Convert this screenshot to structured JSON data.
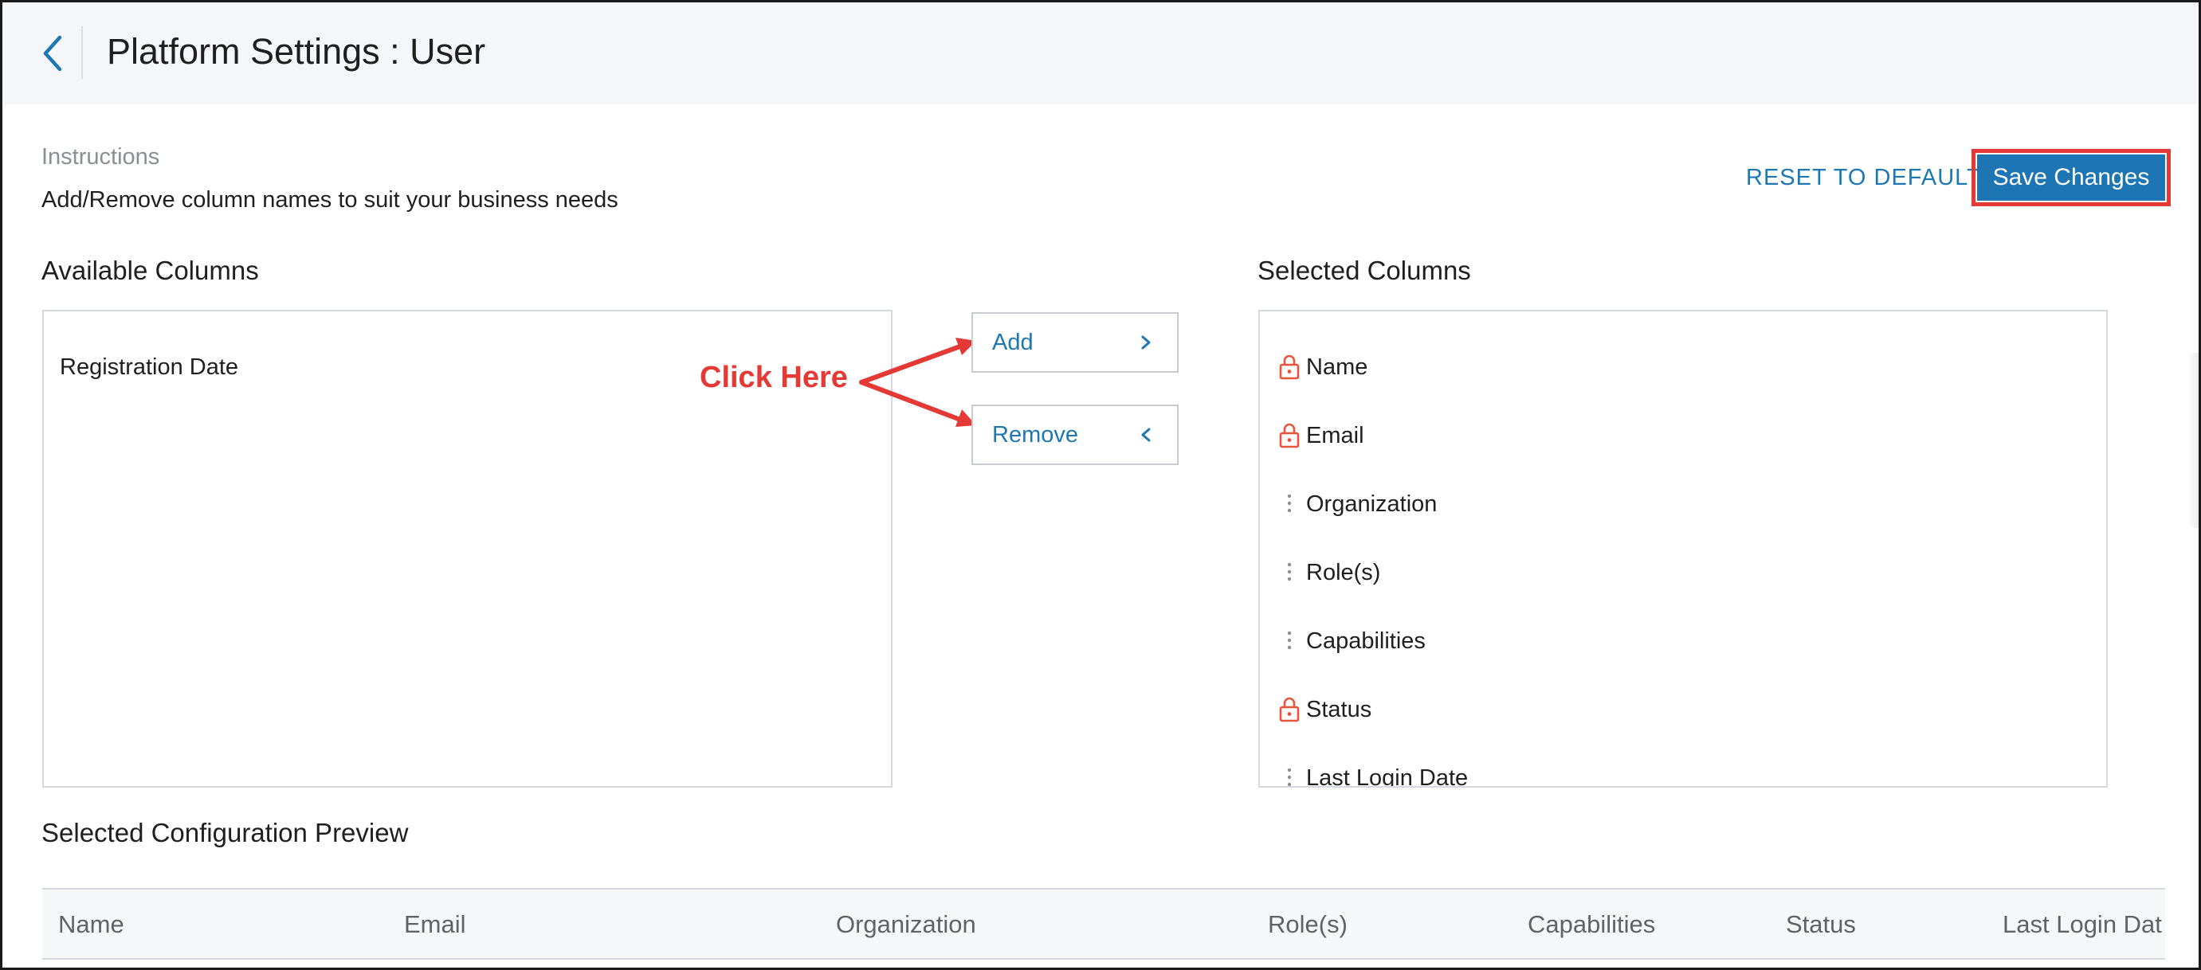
{
  "header": {
    "title": "Platform Settings : User",
    "back_icon": "chevron-left-icon"
  },
  "instructions": {
    "label": "Instructions",
    "text": "Add/Remove column names to suit your business needs"
  },
  "actions": {
    "reset_label": "RESET TO DEFAULT",
    "save_label": "Save Changes"
  },
  "available": {
    "title": "Available Columns",
    "items": [
      "Registration Date"
    ]
  },
  "transfer": {
    "add_label": "Add",
    "remove_label": "Remove",
    "annotation": "Click Here"
  },
  "selected": {
    "title": "Selected Columns",
    "items": [
      {
        "label": "Name",
        "icon": "lock-icon"
      },
      {
        "label": "Email",
        "icon": "lock-icon"
      },
      {
        "label": "Organization",
        "icon": "drag-handle-icon"
      },
      {
        "label": "Role(s)",
        "icon": "drag-handle-icon"
      },
      {
        "label": "Capabilities",
        "icon": "drag-handle-icon"
      },
      {
        "label": "Status",
        "icon": "lock-icon"
      },
      {
        "label": "Last Login Date",
        "icon": "drag-handle-icon"
      }
    ]
  },
  "preview": {
    "title": "Selected Configuration Preview",
    "columns": [
      "Name",
      "Email",
      "Organization",
      "Role(s)",
      "Capabilities",
      "Status",
      "Last Login Dat"
    ]
  },
  "colors": {
    "accent": "#1e75b3",
    "link": "#1d77b2",
    "lock": "#e8553b",
    "annotation": "#e53935"
  }
}
